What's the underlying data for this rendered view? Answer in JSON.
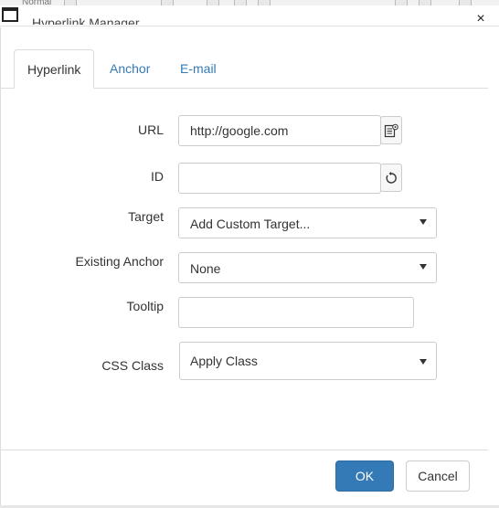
{
  "toolbar": {
    "style_select": "Normal"
  },
  "dialog": {
    "title": "Hyperlink Manager",
    "close_glyph": "×"
  },
  "tabs": [
    {
      "label": "Hyperlink",
      "active": true
    },
    {
      "label": "Anchor",
      "active": false
    },
    {
      "label": "E-mail",
      "active": false
    }
  ],
  "form": {
    "url": {
      "label": "URL",
      "value": "http://google.com"
    },
    "id": {
      "label": "ID",
      "value": ""
    },
    "target": {
      "label": "Target",
      "selected": "Add Custom Target..."
    },
    "existing_anchor": {
      "label": "Existing Anchor",
      "selected": "None"
    },
    "tooltip": {
      "label": "Tooltip",
      "value": ""
    },
    "css_class": {
      "label": "CSS Class",
      "selected": "Apply Class"
    }
  },
  "buttons": {
    "ok": "OK",
    "cancel": "Cancel"
  },
  "colors": {
    "primary": "#337ab7",
    "link": "#337ab7",
    "border": "#cccccc"
  },
  "icons": [
    "window-icon",
    "close-icon",
    "document-manager-icon",
    "refresh-icon",
    "caret-down-icon"
  ]
}
